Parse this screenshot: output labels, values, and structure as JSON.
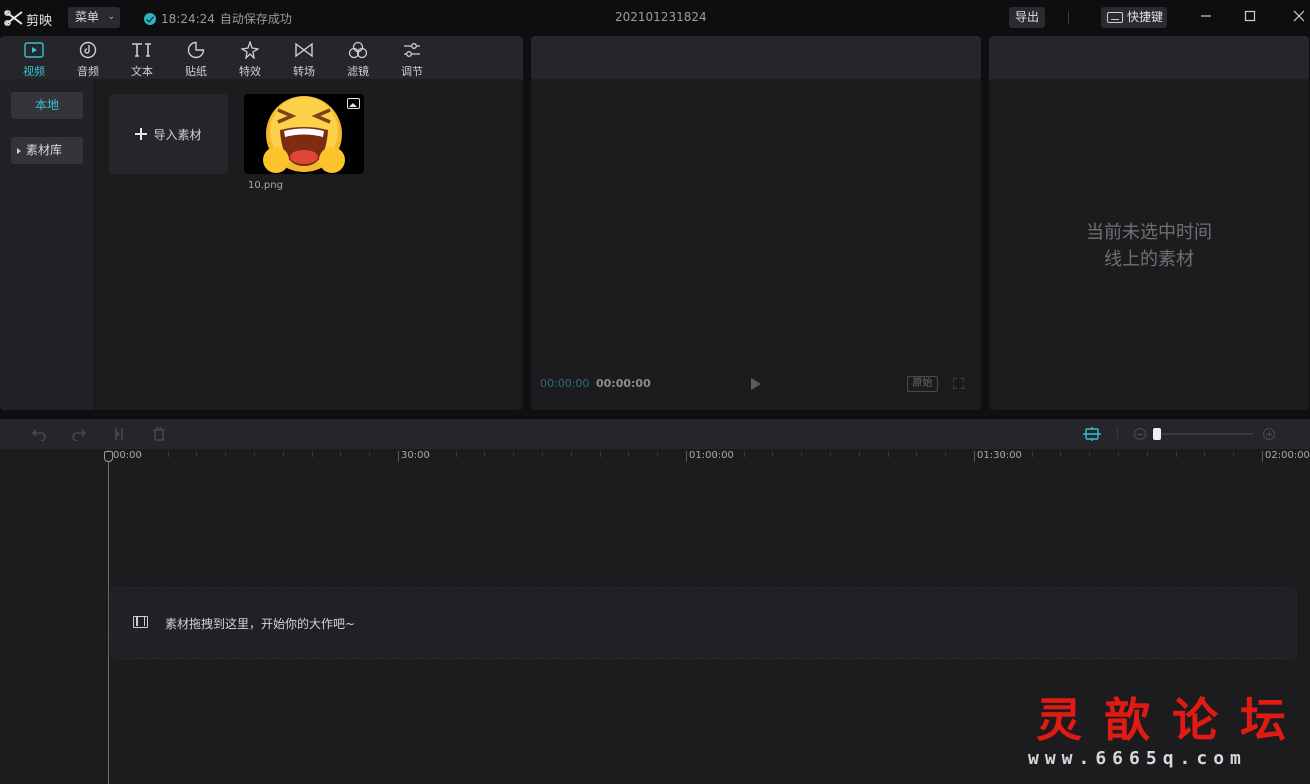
{
  "titlebar": {
    "app_name": "剪映",
    "menu_label": "菜单",
    "save_time": "18:24:24",
    "save_text": "自动保存成功",
    "project_name": "202101231824",
    "export_label": "导出",
    "shortcut_label": "快捷键"
  },
  "media": {
    "tabs": [
      {
        "label": "视频",
        "icon": "video-icon"
      },
      {
        "label": "音频",
        "icon": "audio-icon"
      },
      {
        "label": "文本",
        "icon": "text-icon"
      },
      {
        "label": "贴纸",
        "icon": "sticker-icon"
      },
      {
        "label": "特效",
        "icon": "effects-icon"
      },
      {
        "label": "转场",
        "icon": "transition-icon"
      },
      {
        "label": "滤镜",
        "icon": "filter-icon"
      },
      {
        "label": "调节",
        "icon": "adjust-icon"
      }
    ],
    "side": {
      "local": "本地",
      "library": "素材库"
    },
    "import_label": "导入素材",
    "items": [
      {
        "name": "10.png"
      }
    ]
  },
  "preview": {
    "current_time": "00:00:00",
    "total_time": "00:00:00",
    "ratio_label": "原始"
  },
  "attributes": {
    "empty_line1": "当前未选中时间",
    "empty_line2": "线上的素材"
  },
  "timeline": {
    "ruler_labels": [
      "00:00",
      "30:00",
      "01:00:00",
      "01:30:00",
      "02:00:00"
    ],
    "drop_hint": "素材拖拽到这里，开始你的大作吧~"
  },
  "watermark": {
    "title": "灵歆论坛",
    "url": "www.6665q.com"
  },
  "colors": {
    "accent": "#34c3d3",
    "panel": "#1c1c1f",
    "header": "#26262a",
    "watermark_red": "#e11a14"
  }
}
